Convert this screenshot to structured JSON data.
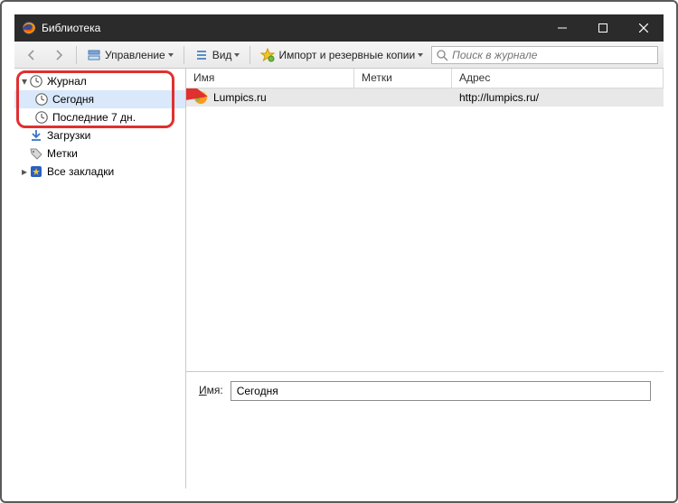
{
  "window": {
    "title": "Библиотека"
  },
  "toolbar": {
    "manage": "Управление",
    "view": "Вид",
    "import": "Импорт и резервные копии",
    "search_placeholder": "Поиск в журнале"
  },
  "sidebar": {
    "history": "Журнал",
    "today": "Сегодня",
    "last7": "Последние 7 дн.",
    "downloads": "Загрузки",
    "tags": "Метки",
    "allbookmarks": "Все закладки"
  },
  "columns": {
    "name": "Имя",
    "tags": "Метки",
    "address": "Адрес"
  },
  "rows": [
    {
      "name": "Lumpics.ru",
      "tags": "",
      "address": "http://lumpics.ru/"
    }
  ],
  "details": {
    "name_label_prefix": "И",
    "name_label_rest": "мя:",
    "name_value": "Сегодня"
  }
}
